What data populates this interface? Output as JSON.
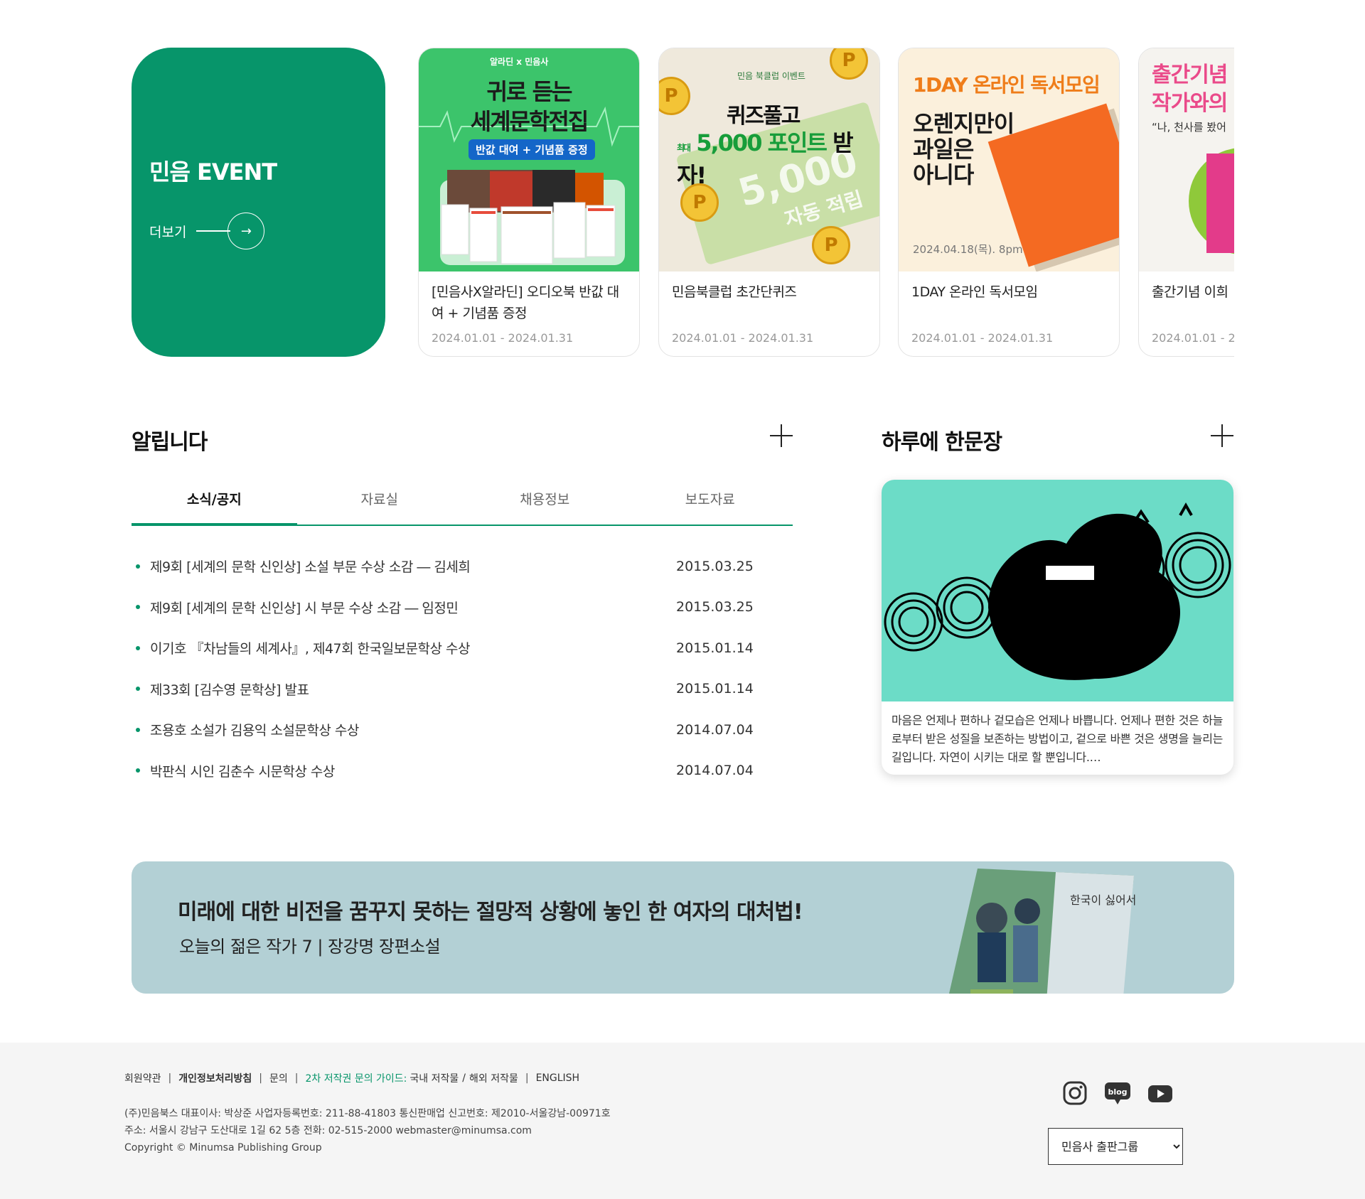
{
  "event": {
    "title": "민음 EVENT",
    "more_label": "더보기",
    "items": [
      {
        "title": "[민음사X알라딘] 오디오북 반값 대여 + 기념품 증정",
        "date": "2024.01.01 - 2024.01.31",
        "thumb": {
          "logo": "알라딘 x 민음사",
          "headline1": "귀로 듣는",
          "headline2": "세계문학전집",
          "badge": "반값 대여 + 기념품 증정"
        }
      },
      {
        "title": "민음북클럽 초간단퀴즈",
        "date": "2024.01.01 - 2024.01.31",
        "thumb": {
          "small": "민음 북클럽 이벤트",
          "headline1": "퀴즈풀고",
          "headline2a": "최대",
          "headline2b": "5,000 포인트",
          "headline2c": "받자!",
          "big": "5,000",
          "big_sub": "자동 적립",
          "coin": "P"
        }
      },
      {
        "title": "1DAY 온라인 독서모임",
        "date": "2024.01.01 - 2024.01.31",
        "thumb": {
          "headline": "1DAY 온라인 독서모임",
          "sub": "오렌지만이\n과일은\n아니다",
          "date": "2024.04.18(목). 8pm"
        }
      },
      {
        "title": "출간기념 이희",
        "date": "2024.01.01 - 2",
        "thumb": {
          "headline": "출간기념\n작가와의",
          "sub": "“나, 천사를 봤어"
        }
      }
    ]
  },
  "notice": {
    "title": "알립니다",
    "tabs": [
      "소식/공지",
      "자료실",
      "채용정보",
      "보도자료"
    ],
    "active_tab": 0,
    "rows": [
      {
        "title": "제9회 [세계의 문학 신인상] 소설 부문 수상 소감 ― 김세희",
        "date": "2015.03.25"
      },
      {
        "title": "제9회 [세계의 문학 신인상] 시 부문 수상 소감 ― 임정민",
        "date": "2015.03.25"
      },
      {
        "title": "이기호 『차남들의 세계사』, 제47회 한국일보문학상 수상",
        "date": "2015.01.14"
      },
      {
        "title": "제33회 [김수영 문학상] 발표",
        "date": "2015.01.14"
      },
      {
        "title": "조용호 소설가 김용익 소설문학상 수상",
        "date": "2014.07.04"
      },
      {
        "title": "박판식 시인 김춘수 시문학상 수상",
        "date": "2014.07.04"
      }
    ]
  },
  "sentence": {
    "title": "하루에 한문장",
    "text": "마음은 언제나 편하나 겉모습은 언제나 바쁩니다. 언제나 편한 것은 하늘로부터 받은 성질을 보존하는 방법이고, 겉으로 바쁜 것은 생명을 늘리는 길입니다. 자연이 시키는 대로 할 뿐입니다.…"
  },
  "banner": {
    "headline": "미래에 대한 비전을 꿈꾸지 못하는 절망적 상황에 놓인 한 여자의 대처법!",
    "sub": "오늘의 젊은 작가 7 | 장강명 장편소설",
    "book_title": "한국이 싫어서"
  },
  "footer": {
    "links": {
      "terms": "회원약관",
      "privacy": "개인정보처리방침",
      "contact": "문의",
      "guide_label": "2차 저작권 문의 가이드:",
      "domestic": "국내 저작물",
      "slash": "/",
      "overseas": "해외 저작물",
      "english": "ENGLISH"
    },
    "info_line1": "(주)민음북스   대표이사: 박상준   사업자등록번호: 211-88-41803   통신판매업 신고번호: 제2010-서울강남-00971호",
    "info_line2": "주소: 서울시 강남구 도산대로 1길 62 5층   전화: 02-515-2000   webmaster@minumsa.com",
    "copyright": "Copyright © Minumsa Publishing Group",
    "sns": [
      "instagram-icon",
      "blog-icon",
      "youtube-icon"
    ],
    "blog_text": "blog",
    "select_value": "민음사 출판그룹"
  },
  "colors": {
    "brand": "#07956a",
    "banner_bg": "#b3d0d5",
    "sentence_bg": "#6cdcc7"
  }
}
